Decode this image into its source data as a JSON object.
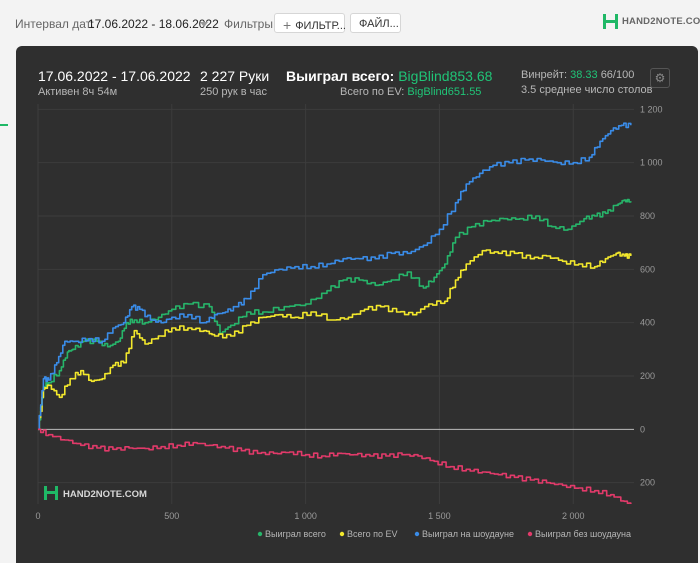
{
  "toolbar": {
    "date_label": "Интервал дат:",
    "date_value": "17.06.2022 - 18.06.2022",
    "filters_label": "Фильтры:",
    "filter_button": "ФИЛЬТР...",
    "file_button": "ФАЙЛ...",
    "logo_text": "HAND2NOTE.COM"
  },
  "summary": {
    "date_range": "17.06.2022 - 17.06.2022",
    "active_time": "Активен 8ч 54м",
    "hands": "2 227 Руки",
    "hands_rate": "250 рук в час",
    "won_label": "Выиграл всего:",
    "won_value": "BigBlind853.68",
    "ev_label": "Всего по EV:",
    "ev_value": "BigBlind651.55",
    "winrate_label": "Винрейт:",
    "winrate_value": "38.33",
    "winrate_rest": "66/100",
    "tables": "3.5 среднее число столов"
  },
  "chart_data": {
    "type": "line",
    "watermark": "HAND2NOTE.COM",
    "xlim": [
      0,
      2227
    ],
    "ylim": [
      -280,
      1220
    ],
    "x_ticks": [
      0,
      500,
      1000,
      1500,
      2000
    ],
    "x_tick_labels": [
      "0",
      "500",
      "1 000",
      "1 500",
      "2 000"
    ],
    "y_ticks": [
      1200,
      1000,
      800,
      600,
      400,
      200,
      0,
      -200
    ],
    "y_tick_labels": [
      "1 200",
      "1 000",
      "800",
      "600",
      "400",
      "200",
      "0",
      "200"
    ],
    "grid": true,
    "legend_position": "bottom-right",
    "series": [
      {
        "name": "Выиграл всего",
        "color": "#27b56a",
        "points": [
          [
            0,
            0
          ],
          [
            20,
            160
          ],
          [
            40,
            175
          ],
          [
            80,
            220
          ],
          [
            110,
            290
          ],
          [
            130,
            300
          ],
          [
            170,
            330
          ],
          [
            220,
            330
          ],
          [
            260,
            310
          ],
          [
            300,
            330
          ],
          [
            330,
            400
          ],
          [
            360,
            410
          ],
          [
            400,
            400
          ],
          [
            450,
            420
          ],
          [
            500,
            450
          ],
          [
            560,
            470
          ],
          [
            640,
            460
          ],
          [
            680,
            360
          ],
          [
            720,
            390
          ],
          [
            780,
            440
          ],
          [
            840,
            440
          ],
          [
            920,
            460
          ],
          [
            1000,
            470
          ],
          [
            1080,
            520
          ],
          [
            1140,
            560
          ],
          [
            1200,
            560
          ],
          [
            1260,
            540
          ],
          [
            1320,
            560
          ],
          [
            1380,
            590
          ],
          [
            1440,
            530
          ],
          [
            1480,
            570
          ],
          [
            1520,
            620
          ],
          [
            1560,
            720
          ],
          [
            1620,
            760
          ],
          [
            1680,
            780
          ],
          [
            1740,
            790
          ],
          [
            1800,
            790
          ],
          [
            1860,
            800
          ],
          [
            1920,
            760
          ],
          [
            1980,
            750
          ],
          [
            2040,
            790
          ],
          [
            2080,
            800
          ],
          [
            2120,
            810
          ],
          [
            2160,
            840
          ],
          [
            2190,
            860
          ],
          [
            2215,
            855
          ]
        ]
      },
      {
        "name": "Всего по EV",
        "color": "#f3e82c",
        "points": [
          [
            0,
            0
          ],
          [
            20,
            150
          ],
          [
            40,
            165
          ],
          [
            80,
            120
          ],
          [
            120,
            190
          ],
          [
            160,
            220
          ],
          [
            200,
            180
          ],
          [
            240,
            190
          ],
          [
            280,
            240
          ],
          [
            320,
            250
          ],
          [
            360,
            370
          ],
          [
            400,
            320
          ],
          [
            450,
            350
          ],
          [
            500,
            380
          ],
          [
            560,
            380
          ],
          [
            620,
            370
          ],
          [
            660,
            350
          ],
          [
            720,
            350
          ],
          [
            780,
            390
          ],
          [
            840,
            420
          ],
          [
            900,
            430
          ],
          [
            960,
            420
          ],
          [
            1020,
            440
          ],
          [
            1100,
            410
          ],
          [
            1160,
            420
          ],
          [
            1220,
            450
          ],
          [
            1280,
            460
          ],
          [
            1340,
            440
          ],
          [
            1400,
            430
          ],
          [
            1460,
            470
          ],
          [
            1520,
            480
          ],
          [
            1560,
            560
          ],
          [
            1600,
            620
          ],
          [
            1660,
            670
          ],
          [
            1720,
            660
          ],
          [
            1780,
            660
          ],
          [
            1840,
            640
          ],
          [
            1900,
            650
          ],
          [
            1960,
            630
          ],
          [
            2020,
            620
          ],
          [
            2080,
            610
          ],
          [
            2120,
            640
          ],
          [
            2160,
            660
          ],
          [
            2190,
            650
          ],
          [
            2215,
            650
          ]
        ]
      },
      {
        "name": "Выиграл на шоудауне",
        "color": "#3a8ce8",
        "points": [
          [
            0,
            0
          ],
          [
            20,
            190
          ],
          [
            40,
            185
          ],
          [
            70,
            250
          ],
          [
            100,
            330
          ],
          [
            140,
            330
          ],
          [
            190,
            340
          ],
          [
            240,
            330
          ],
          [
            280,
            380
          ],
          [
            320,
            400
          ],
          [
            350,
            460
          ],
          [
            380,
            450
          ],
          [
            420,
            410
          ],
          [
            460,
            400
          ],
          [
            500,
            420
          ],
          [
            560,
            430
          ],
          [
            620,
            400
          ],
          [
            660,
            430
          ],
          [
            700,
            440
          ],
          [
            740,
            460
          ],
          [
            780,
            490
          ],
          [
            840,
            580
          ],
          [
            900,
            600
          ],
          [
            960,
            610
          ],
          [
            1020,
            610
          ],
          [
            1080,
            620
          ],
          [
            1140,
            640
          ],
          [
            1200,
            640
          ],
          [
            1260,
            640
          ],
          [
            1320,
            660
          ],
          [
            1380,
            660
          ],
          [
            1440,
            690
          ],
          [
            1500,
            750
          ],
          [
            1560,
            850
          ],
          [
            1600,
            920
          ],
          [
            1650,
            960
          ],
          [
            1700,
            990
          ],
          [
            1760,
            1000
          ],
          [
            1820,
            1010
          ],
          [
            1880,
            1010
          ],
          [
            1940,
            1000
          ],
          [
            2000,
            1000
          ],
          [
            2060,
            1020
          ],
          [
            2100,
            1080
          ],
          [
            2140,
            1120
          ],
          [
            2180,
            1140
          ],
          [
            2215,
            1140
          ]
        ]
      },
      {
        "name": "Выиграл без шоудауна",
        "color": "#e23a6a",
        "points": [
          [
            0,
            0
          ],
          [
            40,
            -20
          ],
          [
            100,
            -40
          ],
          [
            160,
            -60
          ],
          [
            220,
            -70
          ],
          [
            280,
            -75
          ],
          [
            340,
            -70
          ],
          [
            400,
            -72
          ],
          [
            460,
            -65
          ],
          [
            520,
            -60
          ],
          [
            580,
            -50
          ],
          [
            640,
            -60
          ],
          [
            700,
            -70
          ],
          [
            760,
            -80
          ],
          [
            820,
            -90
          ],
          [
            880,
            -90
          ],
          [
            940,
            -85
          ],
          [
            1000,
            -95
          ],
          [
            1060,
            -100
          ],
          [
            1120,
            -90
          ],
          [
            1180,
            -95
          ],
          [
            1240,
            -100
          ],
          [
            1300,
            -100
          ],
          [
            1360,
            -95
          ],
          [
            1420,
            -100
          ],
          [
            1480,
            -120
          ],
          [
            1540,
            -140
          ],
          [
            1600,
            -150
          ],
          [
            1660,
            -160
          ],
          [
            1720,
            -170
          ],
          [
            1780,
            -180
          ],
          [
            1840,
            -190
          ],
          [
            1900,
            -200
          ],
          [
            1960,
            -210
          ],
          [
            2020,
            -220
          ],
          [
            2080,
            -230
          ],
          [
            2140,
            -245
          ],
          [
            2190,
            -270
          ],
          [
            2215,
            -280
          ]
        ]
      }
    ]
  }
}
